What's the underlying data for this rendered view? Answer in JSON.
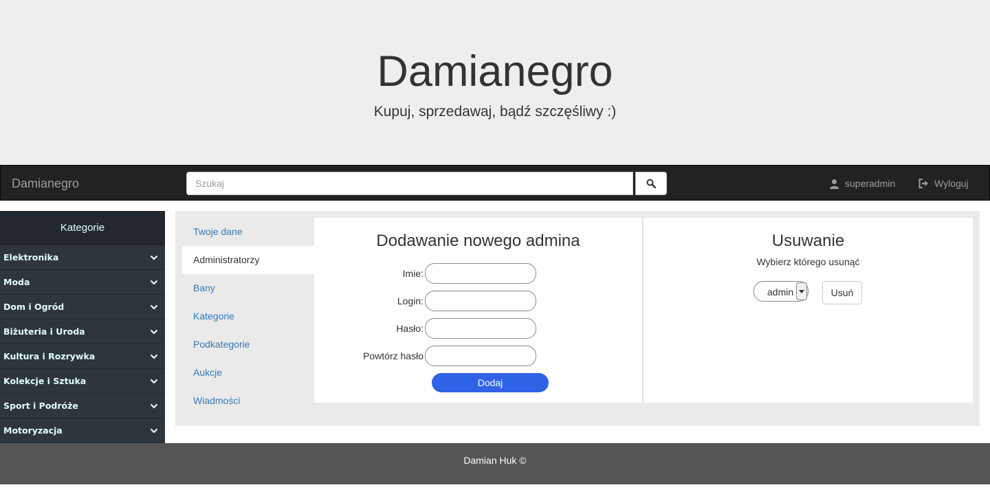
{
  "hero": {
    "title": "Damianegro",
    "subtitle": "Kupuj, sprzedawaj, bądź szczęśliwy :)"
  },
  "navbar": {
    "brand": "Damianegro",
    "search_placeholder": "Szukaj",
    "search_icon": "search-icon",
    "user_label": "superadmin",
    "logout_label": "Wyloguj"
  },
  "sidebar": {
    "header": "Kategorie",
    "items": [
      {
        "label": "Elektronika"
      },
      {
        "label": "Moda"
      },
      {
        "label": "Dom i Ogród"
      },
      {
        "label": "Biżuteria i Uroda"
      },
      {
        "label": "Kultura i Rozrywka"
      },
      {
        "label": "Kolekcje i Sztuka"
      },
      {
        "label": "Sport i Podróże"
      },
      {
        "label": "Motoryzacja"
      }
    ]
  },
  "tabs": [
    {
      "label": "Twoje dane"
    },
    {
      "label": "Administratorzy"
    },
    {
      "label": "Bany"
    },
    {
      "label": "Kategorie"
    },
    {
      "label": "Podkategorie"
    },
    {
      "label": "Aukcje"
    },
    {
      "label": "Wiadmości"
    }
  ],
  "add_admin": {
    "title": "Dodawanie nowego admina",
    "fields": [
      {
        "label": "Imie:"
      },
      {
        "label": "Login:"
      },
      {
        "label": "Hasło:"
      },
      {
        "label": "Powtórz hasło"
      }
    ],
    "submit_label": "Dodaj"
  },
  "remove_admin": {
    "title": "Usuwanie",
    "instruction": "Wybierz którego usunąć",
    "selected": "admin",
    "delete_label": "Usuń"
  },
  "footer": {
    "text": "Damian Huk ©"
  },
  "colors": {
    "accent_button": "#2f62e6",
    "navbar_bg": "#222222",
    "sidebar_bg": "#2e353d",
    "link": "#337ab7"
  }
}
